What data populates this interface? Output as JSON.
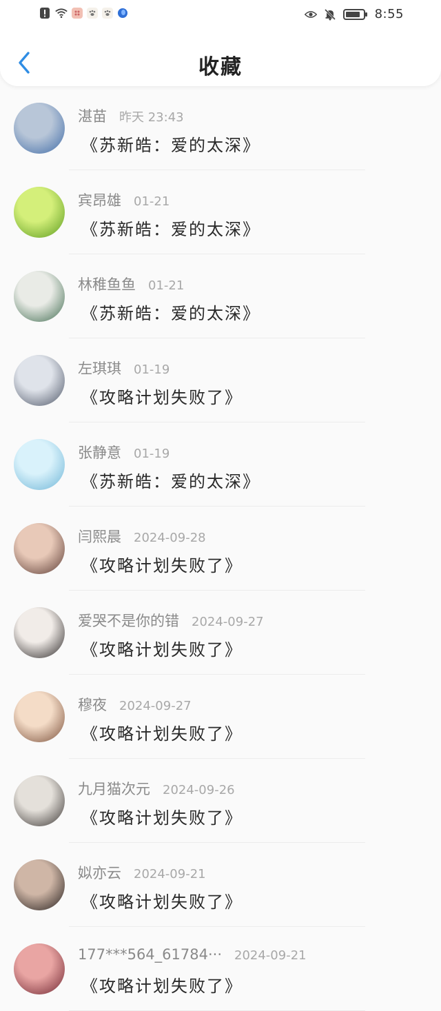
{
  "status_bar": {
    "time": "8:55",
    "left_icons": [
      "alert-icon",
      "wifi-icon",
      "app-notification-icon",
      "paw-icon",
      "paw-icon",
      "globe-icon"
    ],
    "right_icons": [
      "eye-icon",
      "bell-muted-icon",
      "battery-icon"
    ]
  },
  "header": {
    "title": "收藏",
    "back_icon": "chevron-left-icon",
    "accent_color": "#2f8de4"
  },
  "items": [
    {
      "name": "湛苗",
      "time": "昨天 23:43",
      "work": "《苏新皓：爱的太深》",
      "avatar_colors": [
        "#b8c6d8",
        "#3e6aa6"
      ]
    },
    {
      "name": "宾昂雄",
      "time": "01-21",
      "work": "《苏新皓：爱的太深》",
      "avatar_colors": [
        "#d4ef7a",
        "#5a9a1e"
      ]
    },
    {
      "name": "林稚鱼鱼",
      "time": "01-21",
      "work": "《苏新皓：爱的太深》",
      "avatar_colors": [
        "#e9ebe6",
        "#3f6b4f"
      ]
    },
    {
      "name": "左琪琪",
      "time": "01-19",
      "work": "《攻略计划失败了》",
      "avatar_colors": [
        "#dfe3ea",
        "#4d5566"
      ]
    },
    {
      "name": "张静意",
      "time": "01-19",
      "work": "《苏新皓：爱的太深》",
      "avatar_colors": [
        "#d9f2fb",
        "#6db4d6"
      ]
    },
    {
      "name": "闫熙晨",
      "time": "2024-09-28",
      "work": "《攻略计划失败了》",
      "avatar_colors": [
        "#e8c9b8",
        "#5a3a33"
      ]
    },
    {
      "name": "爱哭不是你的错",
      "time": "2024-09-27",
      "work": "《攻略计划失败了》",
      "avatar_colors": [
        "#f1ece8",
        "#2b2727"
      ]
    },
    {
      "name": "穆夜",
      "time": "2024-09-27",
      "work": "《攻略计划失败了》",
      "avatar_colors": [
        "#f4dcc7",
        "#7a4f3a"
      ]
    },
    {
      "name": "九月猫次元",
      "time": "2024-09-26",
      "work": "《攻略计划失败了》",
      "avatar_colors": [
        "#e4e0da",
        "#3a3533"
      ]
    },
    {
      "name": "姒亦云",
      "time": "2024-09-21",
      "work": "《攻略计划失败了》",
      "avatar_colors": [
        "#cfb6a6",
        "#231d1c"
      ]
    },
    {
      "name": "177***564_61784···",
      "time": "2024-09-21",
      "work": "《攻略计划失败了》",
      "avatar_colors": [
        "#e9a5a3",
        "#6e2530"
      ]
    }
  ]
}
